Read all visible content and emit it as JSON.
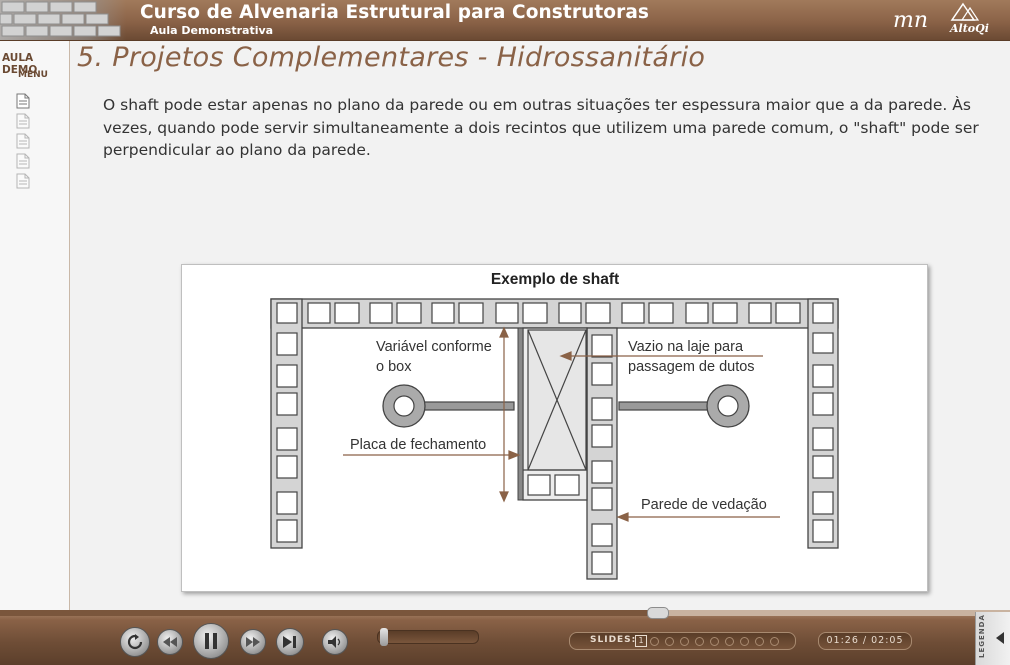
{
  "header": {
    "title": "Curso de Alvenaria Estrutural para Construtoras",
    "subtitle": "Aula Demonstrativa",
    "logo_mn": "mn",
    "logo_altoqi": "AltoQi"
  },
  "sidebar": {
    "aula_demo": "AULA DEMO",
    "menu_label": "MENU",
    "items": [
      {
        "icon": "document-icon",
        "active": true
      },
      {
        "icon": "document-icon",
        "active": false
      },
      {
        "icon": "document-icon",
        "active": false
      },
      {
        "icon": "document-icon",
        "active": false
      },
      {
        "icon": "document-icon",
        "active": false
      }
    ]
  },
  "content": {
    "title": "5. Projetos Complementares - Hidrossanitário",
    "paragraph": "O shaft pode estar apenas no plano da parede ou em outras situações ter espessura maior que a da parede. Às vezes, quando pode servir simultaneamente a dois recintos que utilizem uma parede comum, o \"shaft\"  pode ser perpendicular ao plano da parede."
  },
  "figure": {
    "title": "Exemplo de shaft",
    "labels": {
      "variavel_line1": "Variável conforme",
      "variavel_line2": "o box",
      "vazio_line1": "Vazio na laje para",
      "vazio_line2": "passagem de dutos",
      "placa": "Placa de fechamento",
      "parede": "Parede de vedação"
    }
  },
  "player": {
    "progress": 0.65,
    "volume": 0.02,
    "slides_label": "SLIDES:",
    "current_slide": "1",
    "slide_count": 10,
    "time": "01:26 / 02:05",
    "legenda": "LEGENDA",
    "colors": {
      "accent": "#8a6247",
      "dark": "#5c3f2b"
    }
  }
}
